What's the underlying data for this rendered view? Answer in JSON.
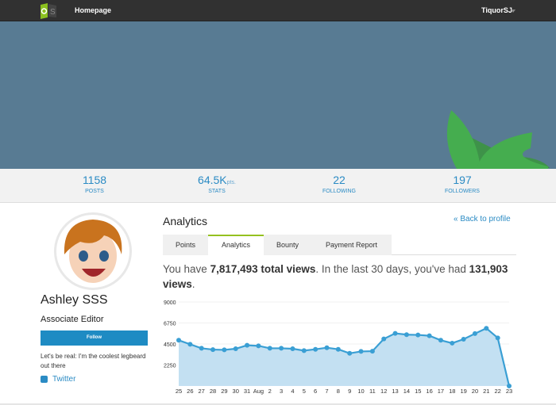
{
  "topbar": {
    "home_label": "Homepage",
    "username": "TiquorSJ",
    "logo_icon": "cs-logo"
  },
  "banner": {
    "color": "#587b93",
    "leaf_color": "#45ad4f"
  },
  "stats": [
    {
      "value": "1158",
      "unit": "",
      "label": "POSTS"
    },
    {
      "value": "64.5K",
      "unit": "pts.",
      "label": "STATS"
    },
    {
      "value": "22",
      "unit": "",
      "label": "FOLLOWING"
    },
    {
      "value": "197",
      "unit": "",
      "label": "FOLLOWERS"
    }
  ],
  "profile": {
    "name": "Ashley SSS",
    "role": "Associate Editor",
    "follow_label": "Follow",
    "bio": "Let's be real: I'm the coolest legbeard out there",
    "twitter_label": "Twitter"
  },
  "analytics": {
    "title": "Analytics",
    "back_label": "« Back to profile",
    "tabs": [
      {
        "label": "Points"
      },
      {
        "label": "Analytics",
        "active": true
      },
      {
        "label": "Bounty"
      },
      {
        "label": "Payment Report"
      }
    ],
    "views_prefix": "You have ",
    "total_views": "7,817,493 total views",
    "views_middle": ". In the last 30 days, you've had ",
    "recent_views": "131,903 views",
    "views_suffix": "."
  },
  "chart_data": {
    "type": "area",
    "color": "#3a9fd4",
    "fill": "#c3e0f2",
    "x": [
      "25",
      "26",
      "27",
      "28",
      "29",
      "30",
      "31",
      "Aug",
      "2",
      "3",
      "4",
      "5",
      "6",
      "7",
      "8",
      "9",
      "10",
      "11",
      "12",
      "13",
      "14",
      "15",
      "16",
      "17",
      "18",
      "19",
      "20",
      "21",
      "22",
      "23"
    ],
    "values": [
      4900,
      4470,
      4040,
      3900,
      3870,
      3990,
      4360,
      4300,
      4040,
      4040,
      3990,
      3790,
      3930,
      4100,
      3930,
      3500,
      3700,
      3730,
      5040,
      5640,
      5500,
      5470,
      5380,
      4900,
      4590,
      5010,
      5610,
      6180,
      5150,
      0
    ],
    "yticks": [
      2250,
      4500,
      6750,
      9000
    ],
    "ylim": [
      0,
      9000
    ],
    "grid": true
  }
}
